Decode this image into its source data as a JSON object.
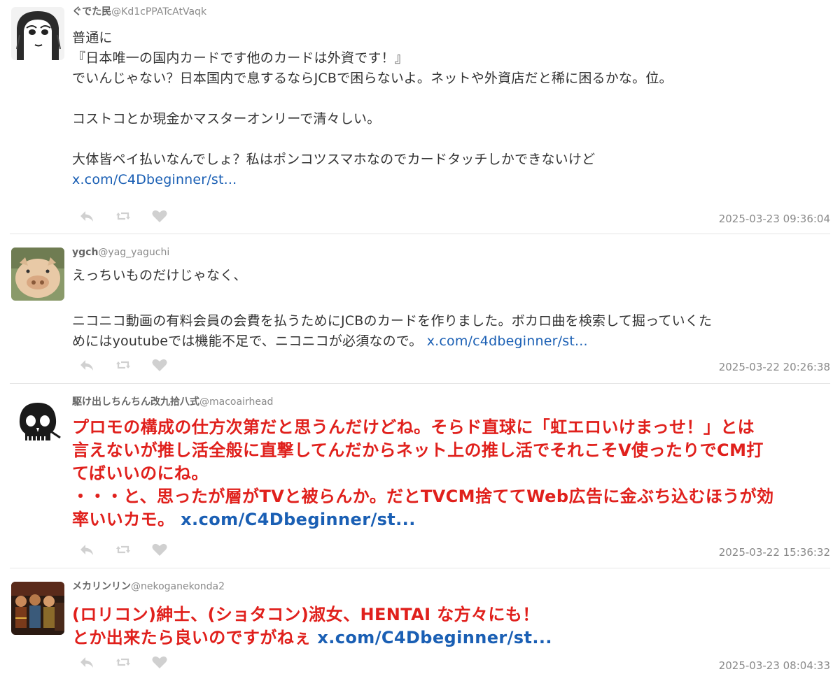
{
  "tweets": [
    {
      "name": "ぐでた民",
      "handle": "@Kd1cPPATcAtVaqk",
      "lines": [
        "普通に",
        "『日本唯一の国内カードです他のカードは外資です！』",
        "でいんじゃない？日本国内で息するならJCBで困らないよ。ネットや外資店だと稀に困るかな。位。",
        "",
        "コストコとか現金かマスターオンリーで清々しい。",
        "",
        "大体皆ペイ払いなんでしょ？私はポンコツスマホなのでカードタッチしかできないけど"
      ],
      "link": "x.com/C4Dbeginner/st...",
      "timestamp": "2025-03-23 09:36:04"
    },
    {
      "name": "ygch",
      "handle": "@yag_yaguchi",
      "lines": [
        "えっちいものだけじゃなく、",
        "",
        "ニコニコ動画の有料会員の会費を払うためにJCBのカードを作りました。ボカロ曲を検索して掘っていくた",
        "めにはyoutubeでは機能不足で、ニコニコが必須なので。"
      ],
      "link": "x.com/c4dbeginner/st...",
      "timestamp": "2025-03-22 20:26:38"
    },
    {
      "name": "駆け出しちんちん改九拾八式",
      "handle": "@macoairhead",
      "lines": [
        "プロモの構成の仕方次第だと思うんだけどね。そらド直球に「虹エロいけまっせ！」とは",
        "言えないが推し活全般に直撃してんだからネット上の推し活でそれこそV使ったりでCM打",
        "てばいいのにね。",
        "・・・と、思ったが層がTVと被らんか。だとTVCM捨ててWeb広告に金ぶち込むほうが効",
        "率いいカモ。"
      ],
      "link": "x.com/C4Dbeginner/st...",
      "timestamp": "2025-03-22 15:36:32"
    },
    {
      "name": "メカリンリン",
      "handle": "@nekoganekonda2",
      "lines": [
        "(ロリコン)紳士、(ショタコン)淑女、HENTAI な方々にも！",
        "とか出来たら良いのですがねぇ"
      ],
      "link": "x.com/C4Dbeginner/st...",
      "timestamp": "2025-03-23 08:04:33"
    }
  ],
  "colors": {
    "link": "#1a5fb4",
    "emphasis_red": "#e0201c",
    "icon_gray": "#d0d0d0",
    "timestamp_gray": "#8a8a8a"
  },
  "icons": [
    "reply-icon",
    "retweet-icon",
    "like-icon"
  ]
}
